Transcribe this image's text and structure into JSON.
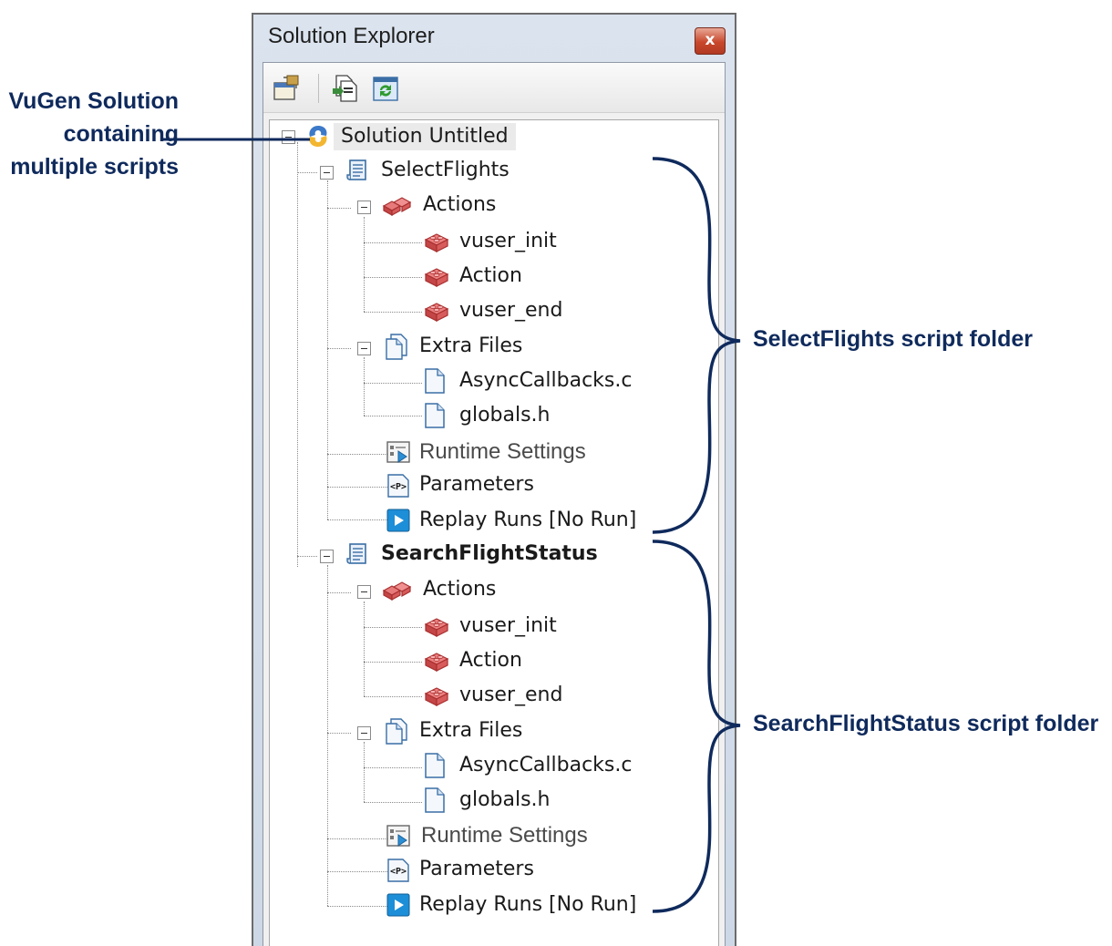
{
  "window": {
    "title": "Solution Explorer",
    "close_label": "x"
  },
  "toolbar": {
    "buttons": [
      {
        "icon": "properties-icon"
      },
      {
        "icon": "copy-icon"
      },
      {
        "icon": "refresh-icon"
      }
    ]
  },
  "tree": {
    "solution": {
      "label": "Solution Untitled",
      "icon": "solution-icon"
    },
    "scripts": [
      {
        "name": "SelectFlights",
        "actions": {
          "label": "Actions",
          "items": [
            "vuser_init",
            "Action",
            "vuser_end"
          ]
        },
        "extra_files": {
          "label": "Extra Files",
          "items": [
            "AsyncCallbacks.c",
            "globals.h"
          ]
        },
        "runtime_settings": "Runtime Settings",
        "parameters": "Parameters",
        "replay_runs": "Replay Runs [No Run]"
      },
      {
        "name": "SearchFlightStatus",
        "actions": {
          "label": "Actions",
          "items": [
            "vuser_init",
            "Action",
            "vuser_end"
          ]
        },
        "extra_files": {
          "label": "Extra Files",
          "items": [
            "AsyncCallbacks.c",
            "globals.h"
          ]
        },
        "runtime_settings": "Runtime Settings",
        "parameters": "Parameters",
        "replay_runs": "Replay Runs [No Run]"
      }
    ]
  },
  "annotations": {
    "solution": [
      "VuGen Solution",
      "containing",
      "multiple scripts"
    ],
    "script1": "SelectFlights script folder",
    "script2": "SearchFlightStatus script folder"
  },
  "colors": {
    "annotation": "#0f2a5c",
    "action_icon": "#cc4b4b",
    "replay_icon": "#1a8fd6"
  }
}
